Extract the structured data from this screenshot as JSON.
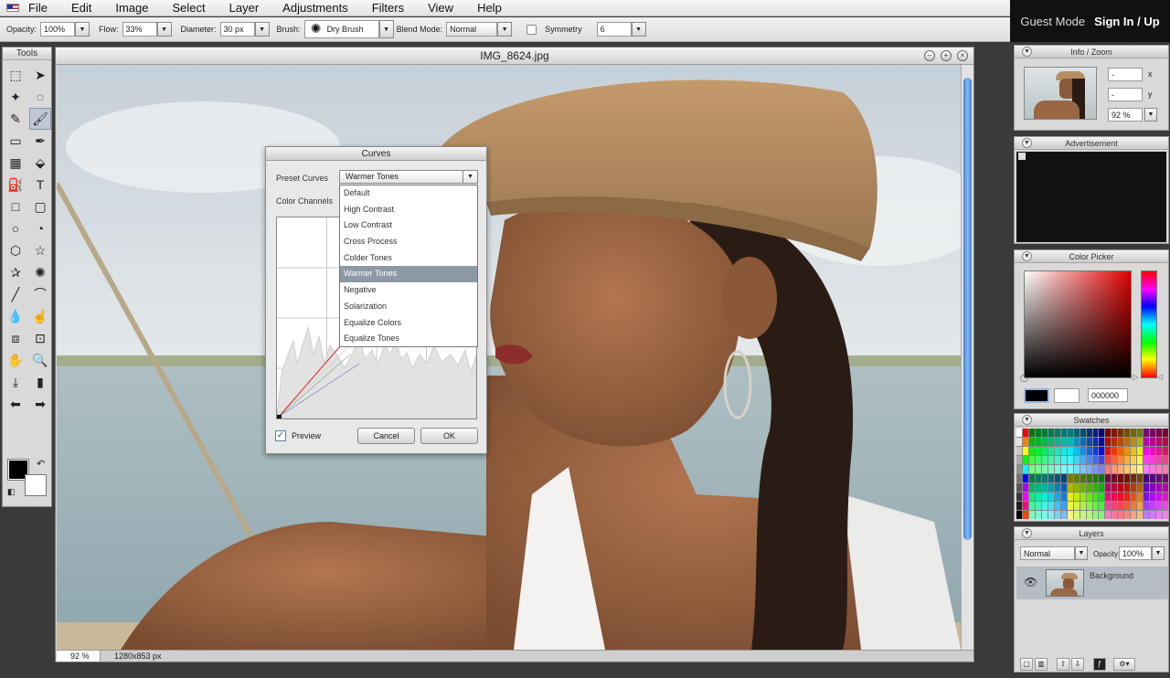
{
  "menubar": {
    "items": [
      "File",
      "Edit",
      "Image",
      "Select",
      "Layer",
      "Adjustments",
      "Filters",
      "View",
      "Help"
    ]
  },
  "account": {
    "guest_mode": "Guest Mode",
    "sign_in": "Sign In / Up"
  },
  "options": {
    "opacity_label": "Opacity:",
    "opacity_value": "100%",
    "flow_label": "Flow:",
    "flow_value": "33%",
    "diameter_label": "Diameter:",
    "diameter_value": "30 px",
    "brush_label": "Brush:",
    "brush_value": "Dry Brush",
    "blend_label": "Blend Mode:",
    "blend_value": "Normal",
    "symmetry_label": "Symmetry",
    "symmetry_value": "6"
  },
  "tools": {
    "title": "Tools",
    "icons": [
      "marquee-icon",
      "move-arrow-icon",
      "magic-wand-icon",
      "lasso-icon",
      "pencil-icon",
      "brush-icon",
      "eraser-icon",
      "airbrush-icon",
      "gradient-icon",
      "paint-bucket-icon",
      "stamp-icon",
      "text-icon",
      "rectangle-icon",
      "rounded-rectangle-icon",
      "ellipse-icon",
      "freeform-icon",
      "hexagon-icon",
      "star-icon",
      "star-outline-icon",
      "gear-shape-icon",
      "line-icon",
      "curve-icon",
      "drop-icon",
      "smudge-icon",
      "crop-icon",
      "transform-icon",
      "hand-icon",
      "zoom-icon",
      "eyedropper-icon",
      "bar-icon",
      "arrow-left-icon",
      "arrow-right-icon"
    ],
    "glyphs": [
      "⬚",
      "➤",
      "✦",
      "◌",
      "✎",
      "🖌",
      "▭",
      "✒",
      "▦",
      "⬙",
      "⛽",
      "T",
      "□",
      "▢",
      "○",
      "◔",
      "⬡",
      "☆",
      "✰",
      "✺",
      "╱",
      "⌒",
      "💧",
      "☝",
      "⧈",
      "⊡",
      "✋",
      "🔍",
      "⤓",
      "▮",
      "⬅",
      "➡"
    ]
  },
  "document": {
    "title": "IMG_8624.jpg",
    "zoom": "92 %",
    "size": "1280x853 px"
  },
  "curves": {
    "title": "Curves",
    "preset_label": "Preset Curves",
    "preset_value": "Warmer Tones",
    "channels_label": "Color Channels",
    "options": [
      "Default",
      "High Contrast",
      "Low Contrast",
      "Cross Process",
      "Colder Tones",
      "Warmer Tones",
      "Negative",
      "Solarization",
      "Equalize Colors",
      "Equalize Tones"
    ],
    "selected_index": 5,
    "preview_label": "Preview",
    "preview_checked": true,
    "cancel_label": "Cancel",
    "ok_label": "OK"
  },
  "panels": {
    "info": {
      "title": "Info / Zoom",
      "x_label": "x",
      "y_label": "y",
      "x_value": "-",
      "y_value": "-",
      "zoom": "92 %"
    },
    "ad": {
      "title": "Advertisement"
    },
    "color_picker": {
      "title": "Color Picker",
      "hex": "000000",
      "fg": "#000000",
      "bg": "#ffffff"
    },
    "swatches": {
      "title": "Swatches"
    },
    "layers": {
      "title": "Layers",
      "blend": "Normal",
      "opacity_label": "Opacity:",
      "opacity": "100%",
      "layer_name": "Background"
    }
  },
  "colors": {
    "accent": "#3c82e0",
    "selected_item": "#8e99a6",
    "ui_gray": "#d9d9d9"
  }
}
